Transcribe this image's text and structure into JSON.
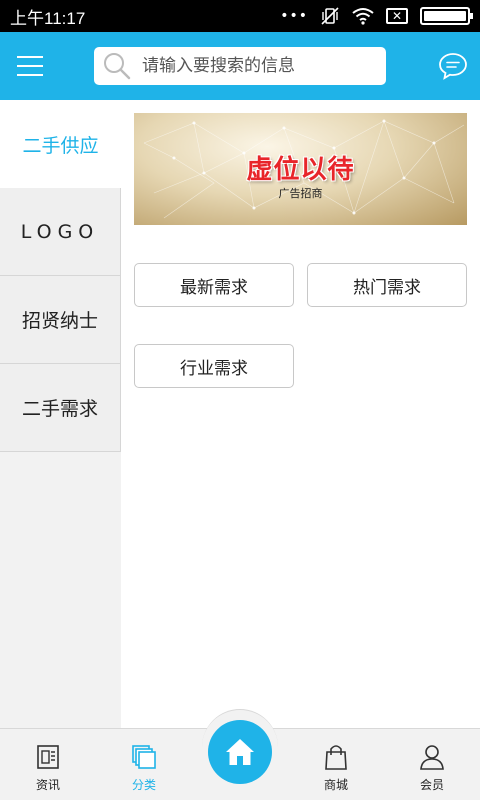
{
  "status_bar": {
    "time": "上午11:17",
    "dots": "•••"
  },
  "header": {
    "search_placeholder": "请输入要搜索的信息",
    "accent_color": "#1fb3e8"
  },
  "sidebar": {
    "items": [
      {
        "label": "二手供应",
        "active": true
      },
      {
        "label": "LOGO",
        "active": false
      },
      {
        "label": "招贤纳士",
        "active": false
      },
      {
        "label": "二手需求",
        "active": false
      }
    ]
  },
  "banner": {
    "title": "虚位以待",
    "subtitle": "广告招商"
  },
  "categories": [
    {
      "label": "最新需求"
    },
    {
      "label": "热门需求"
    },
    {
      "label": "行业需求"
    }
  ],
  "bottom_nav": {
    "tabs": [
      {
        "label": "资讯",
        "icon": "news-icon",
        "active": false
      },
      {
        "label": "分类",
        "icon": "category-icon",
        "active": true
      },
      {
        "label": "",
        "icon": "home-icon",
        "active": false
      },
      {
        "label": "商城",
        "icon": "shopping-bag-icon",
        "active": false
      },
      {
        "label": "会员",
        "icon": "user-icon",
        "active": false
      }
    ]
  }
}
